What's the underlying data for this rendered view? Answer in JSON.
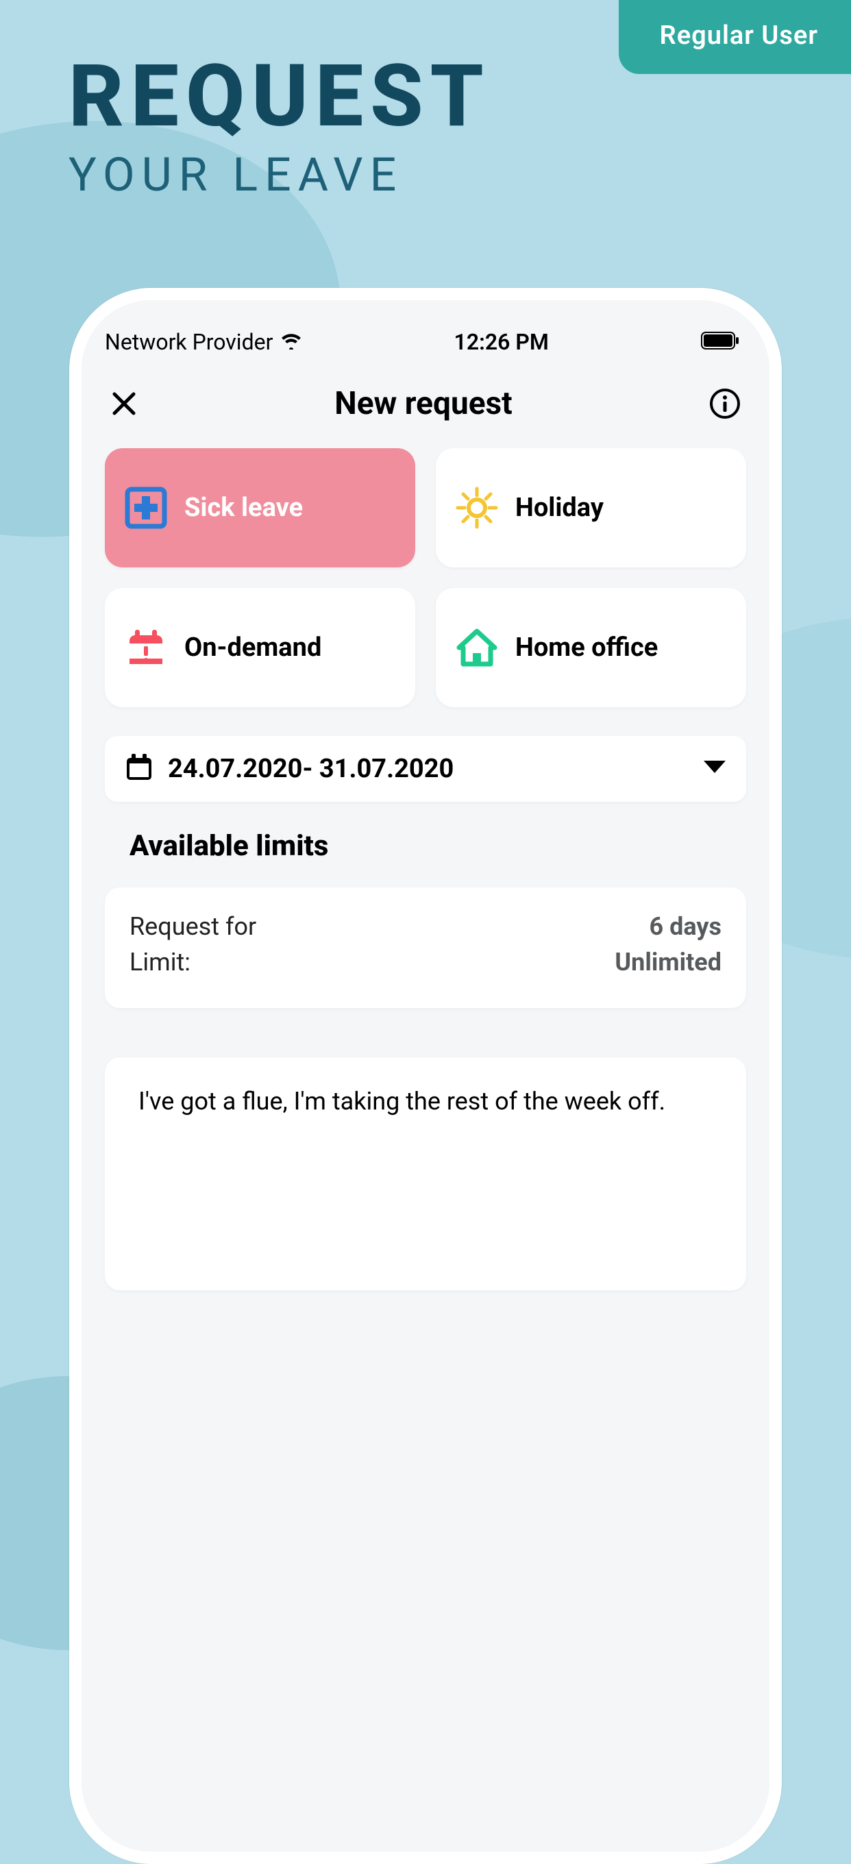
{
  "promo": {
    "badge": "Regular User",
    "title1": "REQUEST",
    "title2": "YOUR LEAVE"
  },
  "status": {
    "carrier": "Network Provider",
    "time": "12:26 PM"
  },
  "header": {
    "title": "New request"
  },
  "types": {
    "sick": "Sick leave",
    "holiday": "Holiday",
    "ondemand": "On-demand",
    "homeoffice": "Home office"
  },
  "date": {
    "range": "24.07.2020- 31.07.2020"
  },
  "limits": {
    "heading": "Available limits",
    "request_for_label": "Request for",
    "request_for_value": "6 days",
    "limit_label": "Limit:",
    "limit_value": "Unlimited"
  },
  "reason": {
    "text": " I've got a flue, I'm taking the rest of the week off."
  }
}
